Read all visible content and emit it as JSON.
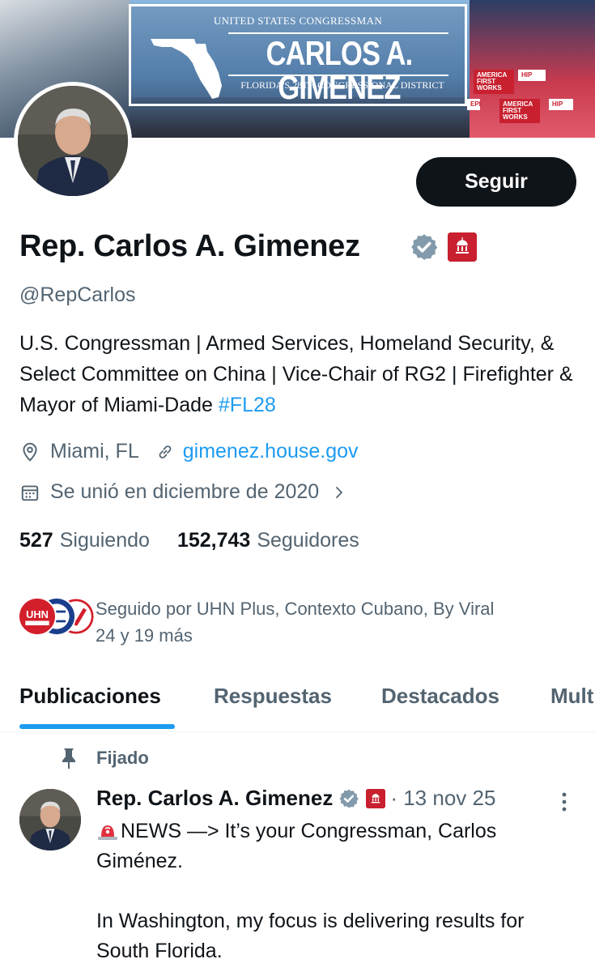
{
  "banner": {
    "line1": "UNITED STATES CONGRESSMAN",
    "name": "CARLOS A. GIMENEZ",
    "line3": "FLORIDA'S 28TH CONGRESSIONAL DISTRICT",
    "signs": [
      "AMERICA FIRST WORKS",
      "HIP",
      "AMERICA FIRST WORKS",
      "HIP",
      "EPI"
    ]
  },
  "profile": {
    "display_name": "Rep. Carlos A. Gimenez",
    "handle": "@RepCarlos",
    "follow_label": "Seguir",
    "bio_text": "U.S. Congressman | Armed Services, Homeland Security, & Select Committee on China | Vice-Chair of RG2 | Firefighter & Mayor of Miami-Dade ",
    "bio_hashtag": "#FL28",
    "location": "Miami, FL",
    "website": "gimenez.house.gov",
    "joined": "Se unió en diciembre de 2020",
    "following_count": "527",
    "following_label": "Siguiendo",
    "followers_count": "152,743",
    "followers_label": "Seguidores",
    "followed_by_line1": "Seguido por UHN Plus, Contexto Cubano, By Viral",
    "followed_by_line2": "24 y 19 más",
    "followed_by_avatar_text": "UHN"
  },
  "tabs": [
    {
      "label": "Publicaciones",
      "active": true
    },
    {
      "label": "Respuestas",
      "active": false
    },
    {
      "label": "Destacados",
      "active": false
    },
    {
      "label": "Mult",
      "active": false
    }
  ],
  "pinned_tweet": {
    "pinned_label": "Fijado",
    "author": "Rep. Carlos A. Gimenez",
    "date": "· 13 nov 25",
    "lines": [
      "NEWS —> It’s your Congressman, Carlos Giménez.",
      "In Washington, my focus is delivering results for South Florida."
    ]
  },
  "colors": {
    "accent": "#1d9bf0",
    "text_primary": "#0f1419",
    "text_secondary": "#536471",
    "verified_gray": "#829aab",
    "affiliation_red": "#c8202f"
  }
}
